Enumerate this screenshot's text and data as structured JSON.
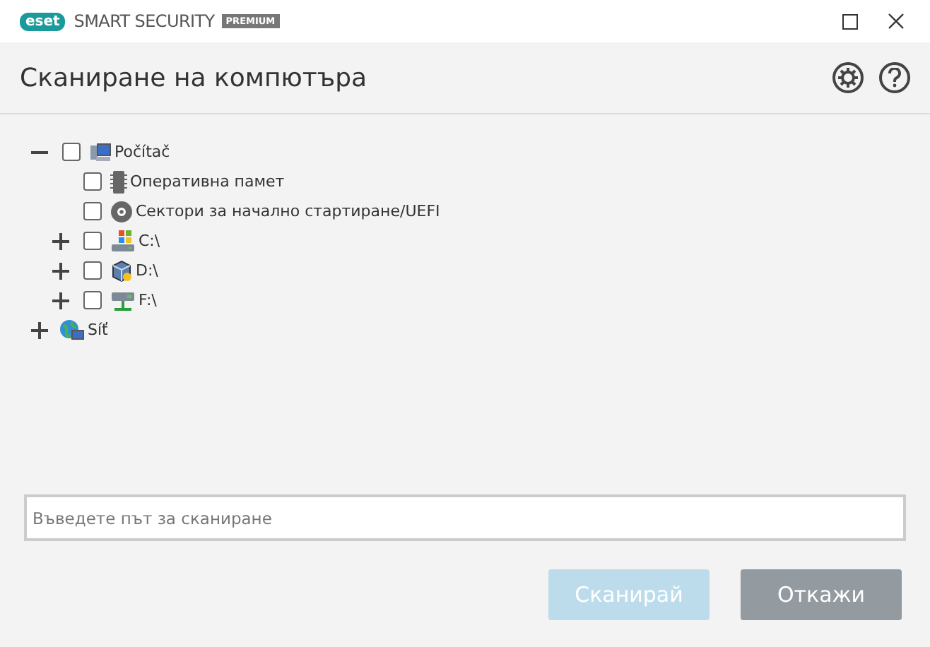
{
  "window": {
    "brand": "eset",
    "product": "SMART SECURITY",
    "edition": "PREMIUM"
  },
  "header": {
    "title": "Сканиране на компютъра"
  },
  "tree": [
    {
      "label": "Počítač",
      "kind": "checkbox",
      "checked": false,
      "expanded": true,
      "children": [
        {
          "label": "Оперативна памет",
          "kind": "checkbox",
          "checked": false
        },
        {
          "label": "Сектори за начално стартиране/UEFI",
          "kind": "checkbox",
          "checked": false
        },
        {
          "label": "C:\\",
          "kind": "checkbox",
          "checked": false,
          "expanded": false
        },
        {
          "label": "D:\\",
          "kind": "checkbox",
          "checked": false,
          "expanded": false
        },
        {
          "label": "F:\\",
          "kind": "checkbox",
          "checked": false,
          "expanded": false
        }
      ]
    },
    {
      "label": "Síť",
      "kind": "plain",
      "expanded": false
    }
  ],
  "path_field": {
    "placeholder": "Въведете път за сканиране"
  },
  "buttons": [
    {
      "label": "Сканирай",
      "disabled": true
    },
    {
      "label": "Откажи",
      "disabled": false
    }
  ]
}
